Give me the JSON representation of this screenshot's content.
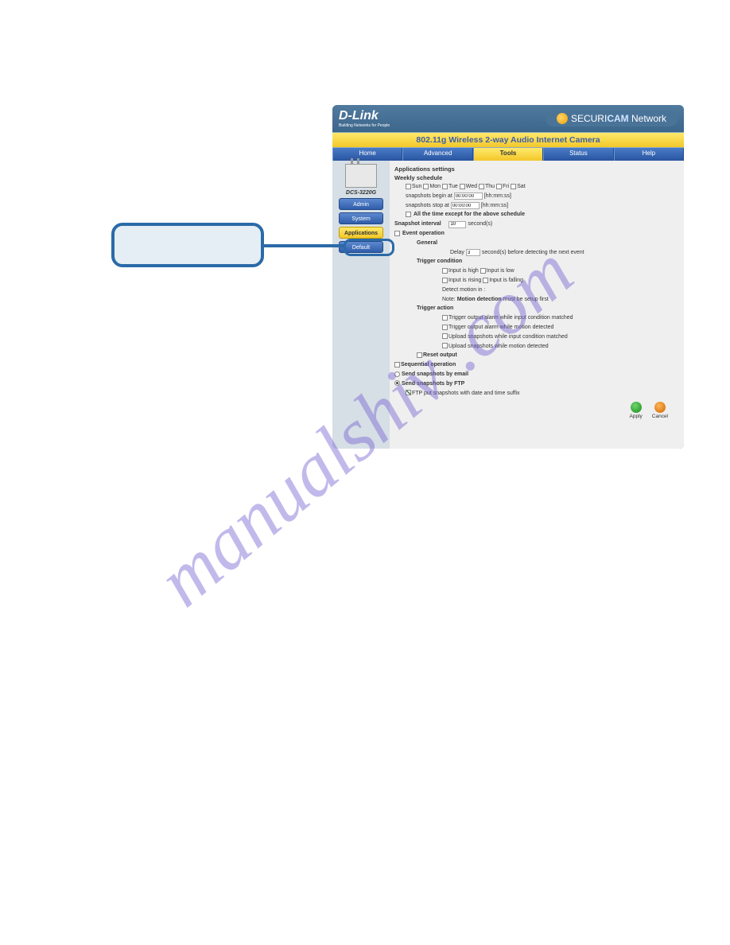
{
  "watermark": "manualshiv .com",
  "router": {
    "brand": "D-Link",
    "brand_tag": "Building Networks for People",
    "securicam_prefix": "SECURI",
    "securicam_accent": "CAM",
    "securicam_suffix": "Network",
    "subtitle": "802.11g Wireless 2-way Audio Internet Camera",
    "tabs": [
      "Home",
      "Advanced",
      "Tools",
      "Status",
      "Help"
    ],
    "model": "DCS-3220G",
    "sidebar": [
      "Admin",
      "System",
      "Applications",
      "Default"
    ],
    "page_title": "Applications settings",
    "weekly": {
      "heading": "Weekly schedule",
      "days": [
        "Sun",
        "Mon",
        "Tue",
        "Wed",
        "Thu",
        "Fri",
        "Sat"
      ],
      "begin_label": "snapshots begin at",
      "begin_val": "00:00:00",
      "begin_hint": "[hh:mm:ss]",
      "stop_label": "snapshots stop at",
      "stop_val": "00:00:00",
      "stop_hint": "[hh:mm:ss]",
      "except_label": "All the time except for the above schedule"
    },
    "interval": {
      "label": "Snapshot interval",
      "val": "10",
      "unit": "second(s)"
    },
    "event": {
      "label": "Event operation",
      "general": "General",
      "delay_pre": "Delay",
      "delay_val": "3",
      "delay_post": "second(s) before detecting the next event",
      "trigger_cond": "Trigger condition",
      "cond": [
        "Input is high",
        "Input is low",
        "Input is rising",
        "Input is falling"
      ],
      "detect_motion": "Detect motion in :",
      "note_pre": "Note:",
      "note_bold": "Motion detection",
      "note_post": "must be setup first",
      "trigger_action": "Trigger action",
      "actions": [
        "Trigger output alarm while input condition matched",
        "Trigger output alarm while motion detected",
        "Upload snapshots while input condition matched",
        "Upload snapshots while motion detected"
      ],
      "reset": "Reset output"
    },
    "seq": {
      "label": "Sequential operation",
      "email": "Send snapshots by email",
      "ftp": "Send snapshots by FTP",
      "suffix": "FTP put snapshots with date and time suffix"
    },
    "apply": "Apply",
    "cancel": "Cancel"
  }
}
